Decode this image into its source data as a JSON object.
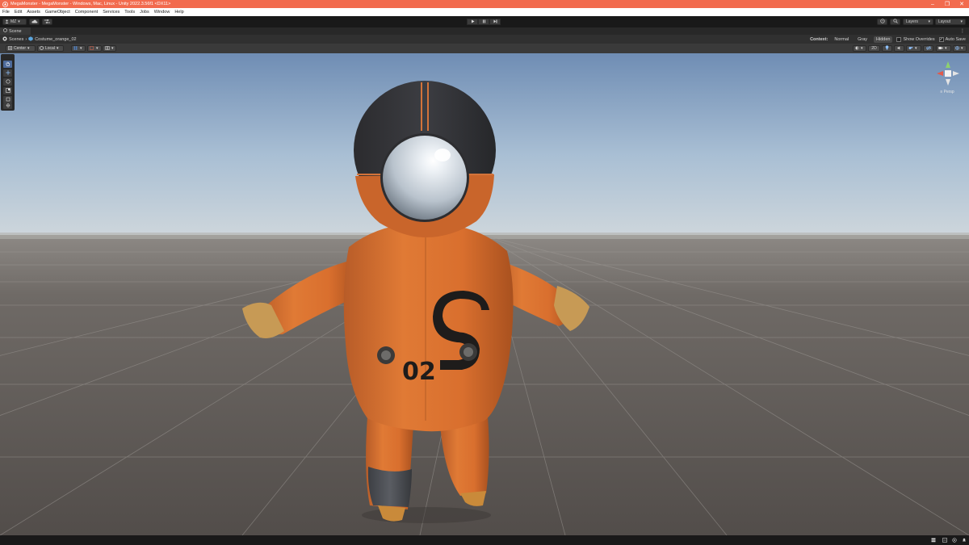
{
  "window": {
    "title": "MegaMonster - MegaMonster - Windows, Mac, Linux - Unity 2022.3.56f1 <DX11>",
    "title_bg": "#f26b4e",
    "minimize": "–",
    "maximize": "❐",
    "close": "✕"
  },
  "menu": [
    "File",
    "Edit",
    "Assets",
    "GameObject",
    "Component",
    "Services",
    "Tools",
    "Jobs",
    "Window",
    "Help"
  ],
  "toolbar": {
    "account": "MZ",
    "layers_label": "Layers",
    "layout_label": "Layout"
  },
  "tabs": {
    "scene": "Scene"
  },
  "breadcrumb": {
    "root": "Scenes",
    "prefab": "Costume_orange_02"
  },
  "context": {
    "label": "Context:",
    "options": [
      "Normal",
      "Gray",
      "Hidden"
    ],
    "selected": "Hidden",
    "show_overrides": "Show Overrides",
    "show_overrides_checked": false,
    "auto_save": "Auto Save",
    "auto_save_checked": true
  },
  "scene_toolbar": {
    "pivot": "Center",
    "space": "Local",
    "mode_2d": "2D"
  },
  "gizmo": {
    "projection": "≡ Persp"
  },
  "model": {
    "chest_number": "02",
    "accent": "#e07a35"
  }
}
